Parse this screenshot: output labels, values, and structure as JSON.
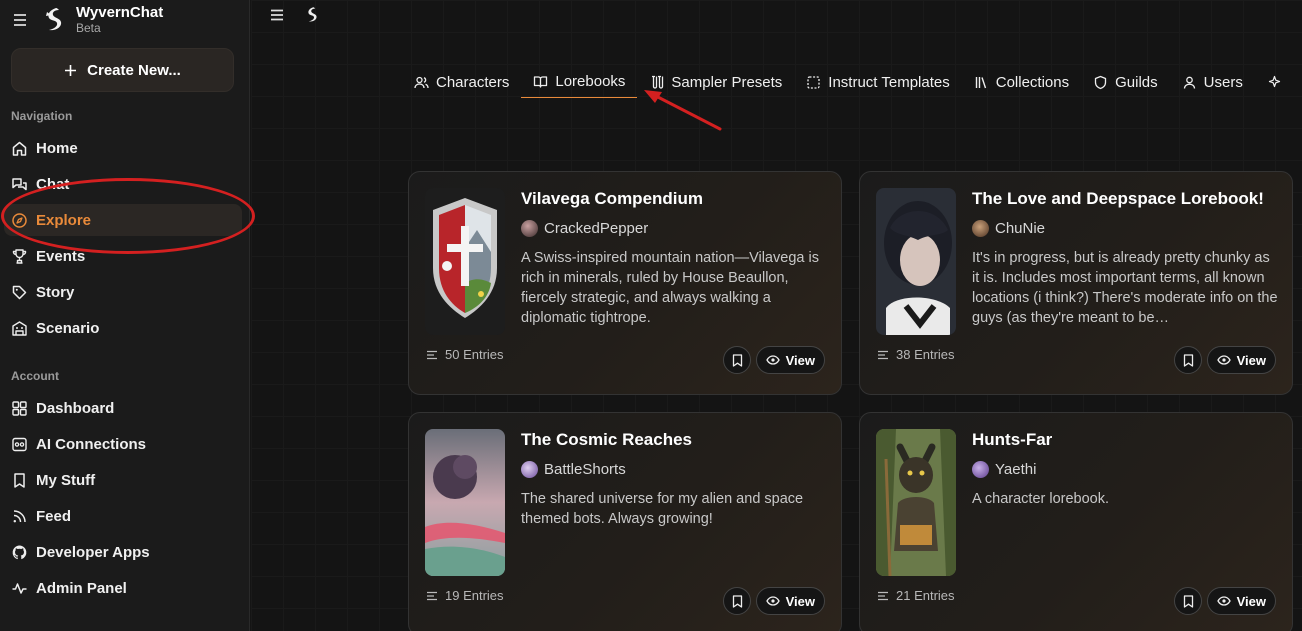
{
  "brand": {
    "name": "WyvernChat",
    "sub": "Beta"
  },
  "create": {
    "label": "Create New..."
  },
  "sections": {
    "navigation": "Navigation",
    "account": "Account"
  },
  "nav": [
    {
      "label": "Home"
    },
    {
      "label": "Chat"
    },
    {
      "label": "Explore"
    },
    {
      "label": "Events"
    },
    {
      "label": "Story"
    },
    {
      "label": "Scenario"
    }
  ],
  "account": [
    {
      "label": "Dashboard"
    },
    {
      "label": "AI Connections"
    },
    {
      "label": "My Stuff"
    },
    {
      "label": "Feed"
    },
    {
      "label": "Developer Apps"
    },
    {
      "label": "Admin Panel"
    }
  ],
  "tabs": [
    {
      "label": "Characters"
    },
    {
      "label": "Lorebooks"
    },
    {
      "label": "Sampler Presets"
    },
    {
      "label": "Instruct Templates"
    },
    {
      "label": "Collections"
    },
    {
      "label": "Guilds"
    },
    {
      "label": "Users"
    }
  ],
  "active_tab": "Lorebooks",
  "active_nav": "Explore",
  "accent_color": "#e98a3a",
  "annotation_color": "#d42020",
  "cards": [
    {
      "title": "Vilavega Compendium",
      "author": "CrackedPepper",
      "desc": "A Swiss-inspired mountain nation—Vilavega is rich in minerals, ruled by House Beaullon, fiercely strategic, and always walking a diplomatic tightrope.",
      "entries": "50 Entries",
      "view": "View"
    },
    {
      "title": "The Love and Deepspace Lorebook!",
      "author": "ChuNie",
      "desc": "It's in progress, but is already pretty chunky as it is. Includes most important terms, all known locations (i think?) There's moderate info on the guys (as they're meant to be…",
      "entries": "38 Entries",
      "view": "View"
    },
    {
      "title": "The Cosmic Reaches",
      "author": "BattleShorts",
      "desc": "The shared universe for my alien and space themed bots. Always growing!",
      "entries": "19 Entries",
      "view": "View"
    },
    {
      "title": "Hunts-Far",
      "author": "Yaethi",
      "desc": "A character lorebook.",
      "entries": "21 Entries",
      "view": "View"
    }
  ]
}
